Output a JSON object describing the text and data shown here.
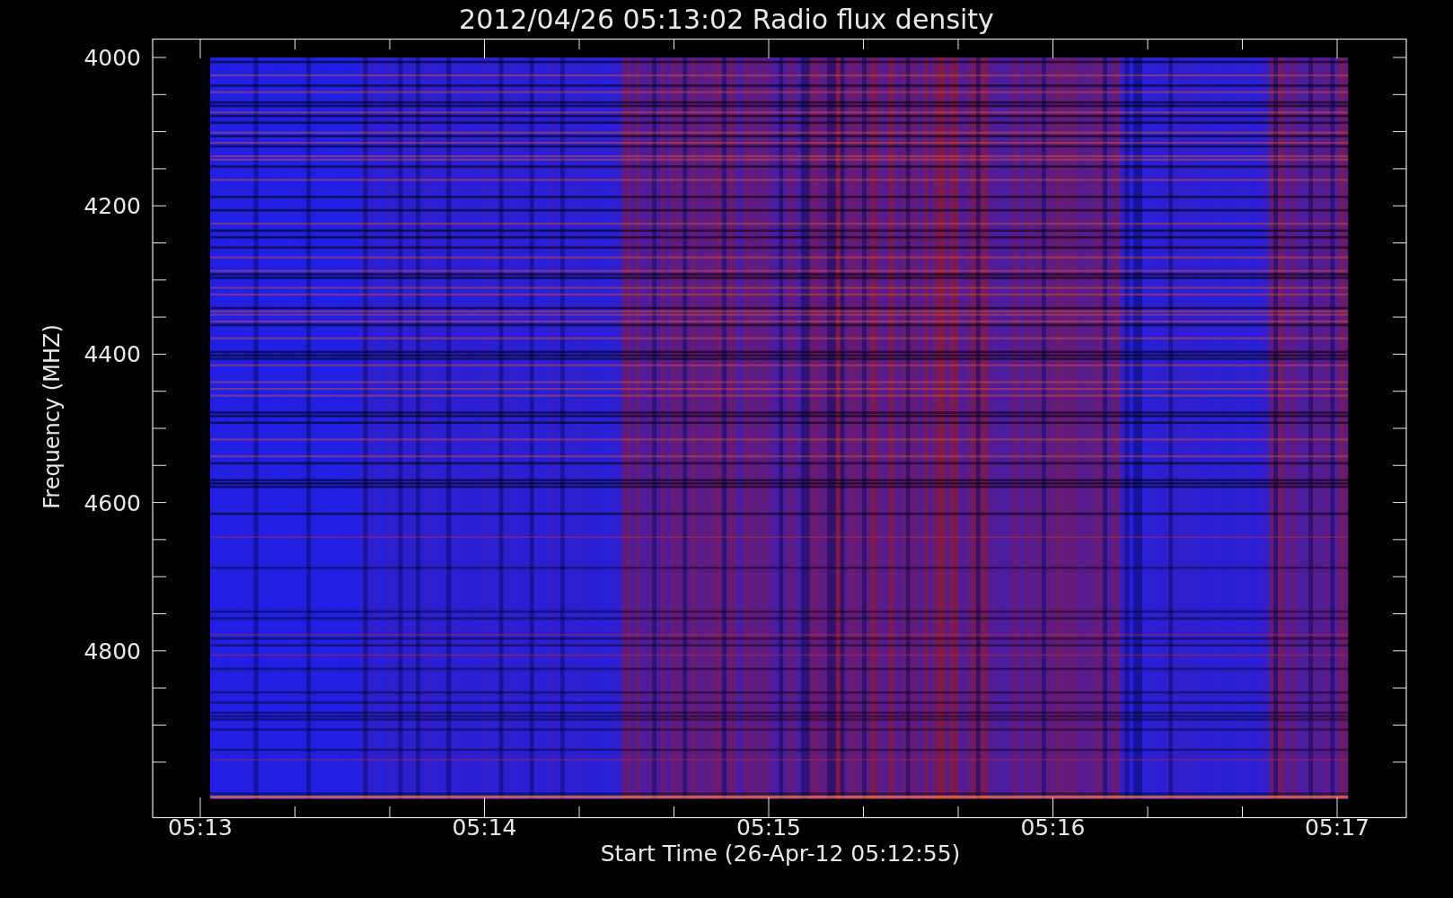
{
  "title": "2012/04/26 05:13:02 Radio flux density",
  "y_axis": {
    "label": "Frequency (MHZ)",
    "ticks": [
      "4000",
      "4200",
      "4400",
      "4600",
      "4800"
    ]
  },
  "x_axis": {
    "label": "Start Time (26-Apr-12 05:12:55)",
    "ticks": [
      "05:13",
      "05:14",
      "05:15",
      "05:16",
      "05:17"
    ]
  }
}
